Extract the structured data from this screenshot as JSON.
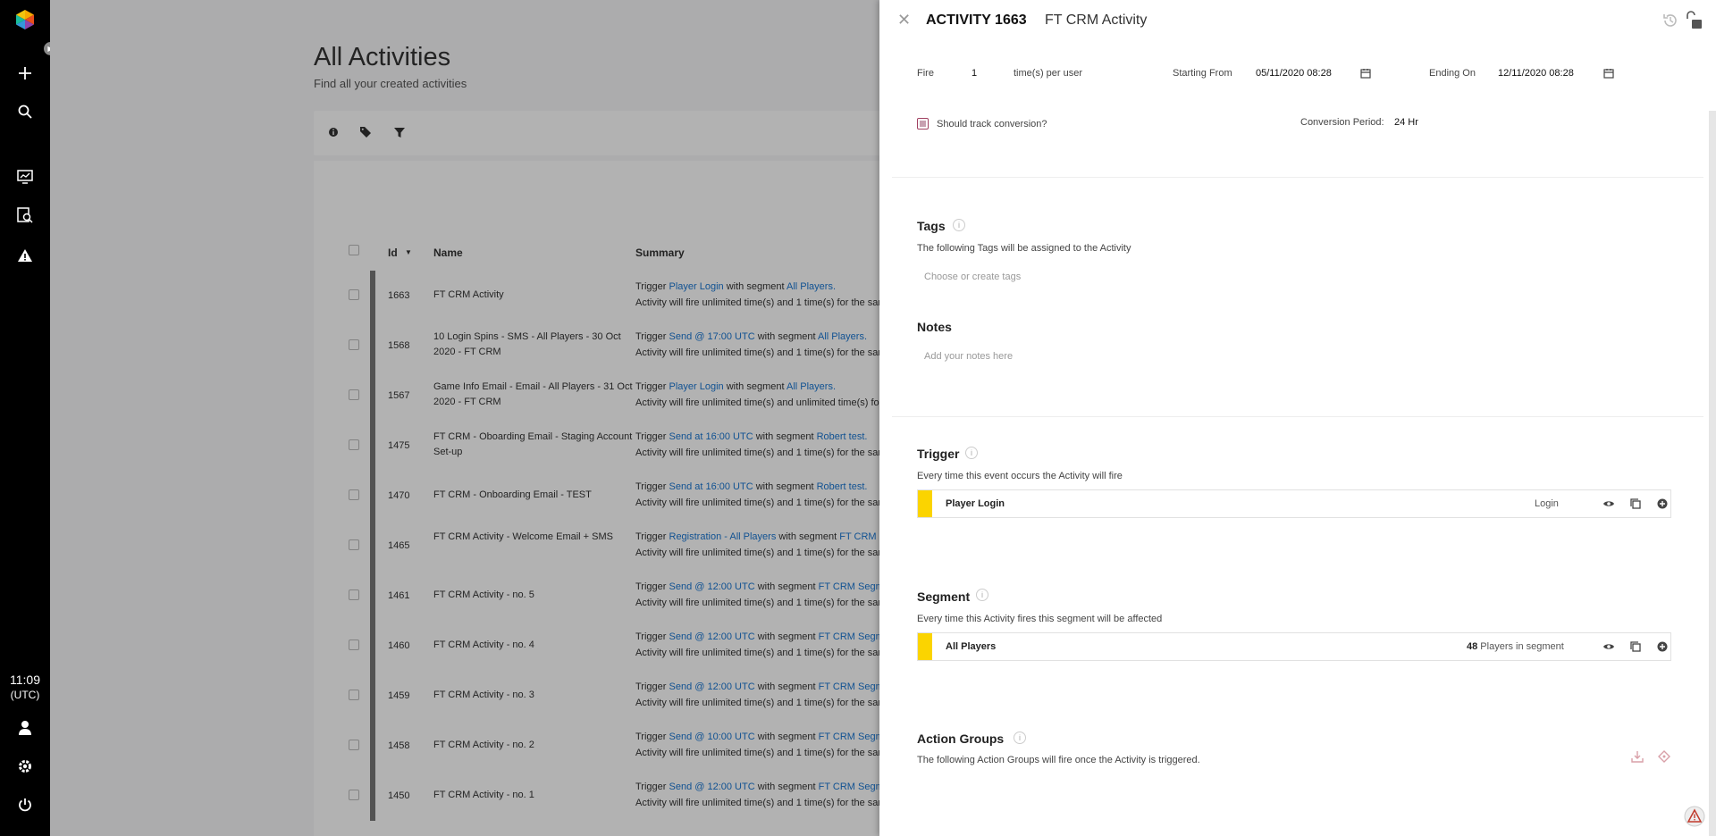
{
  "rail": {
    "time": "11:09",
    "timezone": "(UTC)",
    "icons": [
      "logo-icon",
      "add-icon",
      "search-icon",
      "dashboard-icon",
      "report-search-icon",
      "alert-icon",
      "user-icon",
      "gear-icon",
      "power-icon"
    ]
  },
  "page": {
    "title": "All Activities",
    "subtitle": "Find all your created activities"
  },
  "table": {
    "columns": {
      "id": "Id",
      "name": "Name",
      "summary": "Summary"
    },
    "rows": [
      {
        "id": "1663",
        "name": "FT CRM Activity",
        "trigger_pre": "Trigger ",
        "trigger": "Player Login",
        "mid": " with segment ",
        "segment": "All Players.",
        "line2": "Activity will fire unlimited time(s) and 1 time(s) for the sam"
      },
      {
        "id": "1568",
        "name": "10 Login Spins - SMS - All Players - 30 Oct 2020 - FT CRM",
        "trigger_pre": "Trigger ",
        "trigger": "Send @ 17:00 UTC",
        "mid": " with segment ",
        "segment": "All Players.",
        "line2": "Activity will fire unlimited time(s) and 1 time(s) for the sam"
      },
      {
        "id": "1567",
        "name": "Game Info Email - Email - All Players - 31 Oct 2020 - FT CRM",
        "trigger_pre": "Trigger ",
        "trigger": "Player Login",
        "mid": " with segment ",
        "segment": "All Players.",
        "line2": "Activity will fire unlimited time(s) and unlimited time(s) fo"
      },
      {
        "id": "1475",
        "name": "FT CRM - Oboarding Email - Staging Account Set-up",
        "trigger_pre": "Trigger ",
        "trigger": "Send at 16:00 UTC",
        "mid": " with segment ",
        "segment": "Robert test.",
        "line2": "Activity will fire unlimited time(s) and 1 time(s) for the sam"
      },
      {
        "id": "1470",
        "name": "FT CRM - Onboarding Email - TEST",
        "trigger_pre": "Trigger ",
        "trigger": "Send at 16:00 UTC",
        "mid": " with segment ",
        "segment": "Robert test.",
        "line2": "Activity will fire unlimited time(s) and 1 time(s) for the sam"
      },
      {
        "id": "1465",
        "name": "FT CRM Activity - Welcome Email + SMS",
        "trigger_pre": "Trigger ",
        "trigger": "Registration - All Players",
        "mid": " with segment ",
        "segment": "FT CRM S",
        "line2": "Activity will fire unlimited time(s) and 1 time(s) for the sam"
      },
      {
        "id": "1461",
        "name": "FT CRM Activity - no. 5",
        "trigger_pre": "Trigger ",
        "trigger": "Send @ 12:00 UTC",
        "mid": " with segment ",
        "segment": "FT CRM Segm",
        "line2": "Activity will fire unlimited time(s) and 1 time(s) for the sam"
      },
      {
        "id": "1460",
        "name": "FT CRM Activity - no. 4",
        "trigger_pre": "Trigger ",
        "trigger": "Send @ 12:00 UTC",
        "mid": " with segment ",
        "segment": "FT CRM Segm",
        "line2": "Activity will fire unlimited time(s) and 1 time(s) for the sam"
      },
      {
        "id": "1459",
        "name": "FT CRM Activity - no. 3",
        "trigger_pre": "Trigger ",
        "trigger": "Send @ 12:00 UTC",
        "mid": " with segment ",
        "segment": "FT CRM Segm",
        "line2": "Activity will fire unlimited time(s) and 1 time(s) for the sam"
      },
      {
        "id": "1458",
        "name": "FT CRM Activity - no. 2",
        "trigger_pre": "Trigger ",
        "trigger": "Send @ 10:00 UTC",
        "mid": " with segment ",
        "segment": "FT CRM Segm",
        "line2": "Activity will fire unlimited time(s) and 1 time(s) for the sam"
      },
      {
        "id": "1450",
        "name": "FT CRM Activity - no. 1",
        "trigger_pre": "Trigger ",
        "trigger": "Send @ 12:00 UTC",
        "mid": " with segment ",
        "segment": "FT CRM Segm",
        "line2": "Activity will fire unlimited time(s) and 1 time(s) for the sam"
      }
    ]
  },
  "drawer": {
    "activity_label": "ACTIVITY 1663",
    "activity_name": "FT CRM Activity",
    "fire_label": "Fire",
    "fire_value": "1",
    "fire_unit": "time(s) per user",
    "starting_label": "Starting From",
    "starting_value": "05/11/2020 08:28",
    "ending_label": "Ending On",
    "ending_value": "12/11/2020 08:28",
    "track_conversion_label": "Should track conversion?",
    "conversion_period_label": "Conversion Period:",
    "conversion_period_value": "24 Hr",
    "tags": {
      "title": "Tags",
      "desc": "The following Tags will be assigned to the Activity",
      "placeholder": "Choose or create tags"
    },
    "notes": {
      "title": "Notes",
      "placeholder": "Add your notes here"
    },
    "trigger": {
      "title": "Trigger",
      "desc": "Every time this event occurs the Activity will fire",
      "name": "Player Login",
      "type": "Login"
    },
    "segment": {
      "title": "Segment",
      "desc": "Every time this Activity fires this segment will be affected",
      "name": "All Players",
      "count": "48",
      "count_label": " Players in segment"
    },
    "action_groups": {
      "title": "Action Groups",
      "desc": "The following Action Groups will fire once the Activity is triggered."
    }
  },
  "colors": {
    "accent_yellow": "#fbd400",
    "link_blue": "#1976d2",
    "rail_black": "#000000"
  }
}
